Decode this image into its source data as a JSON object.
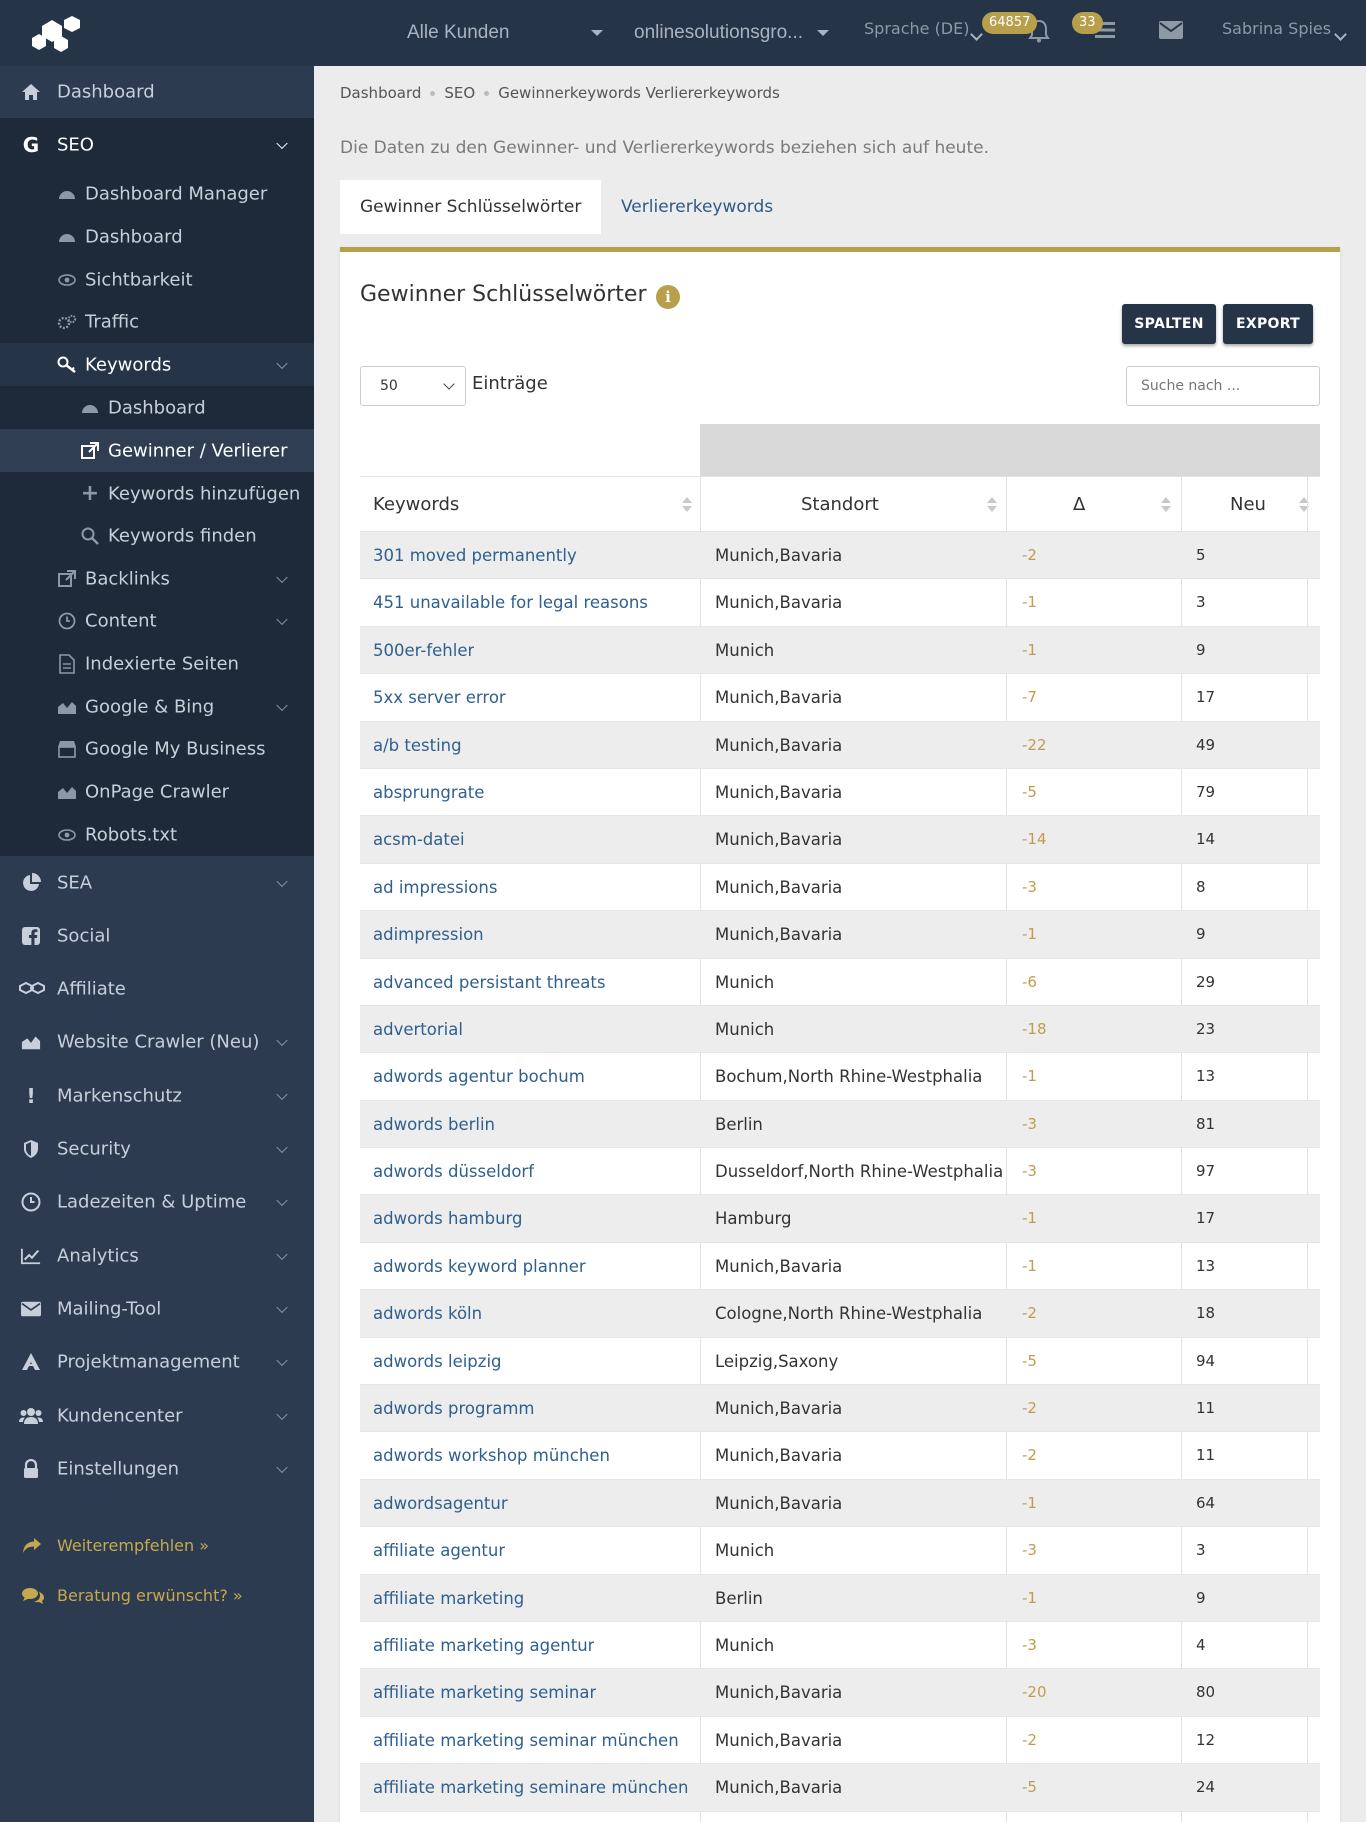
{
  "topbar": {
    "customer_select": "Alle Kunden",
    "project_select": "onlinesolutionsgro...",
    "language": "Sprache (DE)",
    "notifications_count": "64857",
    "tasks_count": "33",
    "user_name": "Sabrina Spies"
  },
  "sidebar": {
    "dashboard": "Dashboard",
    "seo": "SEO",
    "seo_items": {
      "dashboard_manager": "Dashboard Manager",
      "dashboard": "Dashboard",
      "sichtbarkeit": "Sichtbarkeit",
      "traffic": "Traffic",
      "keywords": "Keywords",
      "kw_dashboard": "Dashboard",
      "kw_gewinner": "Gewinner / Verlierer",
      "kw_add": "Keywords hinzufügen",
      "kw_find": "Keywords finden",
      "backlinks": "Backlinks",
      "content": "Content",
      "indexierte": "Indexierte Seiten",
      "google_bing": "Google & Bing",
      "gmb": "Google My Business",
      "onpage": "OnPage Crawler",
      "robots": "Robots.txt"
    },
    "sea": "SEA",
    "social": "Social",
    "affiliate": "Affiliate",
    "website_crawler": "Website Crawler (Neu)",
    "markenschutz": "Markenschutz",
    "security": "Security",
    "ladezeiten": "Ladezeiten & Uptime",
    "analytics": "Analytics",
    "mailing": "Mailing-Tool",
    "projekt": "Projektmanagement",
    "kundencenter": "Kundencenter",
    "einstellungen": "Einstellungen",
    "weiterempfehlen": "Weiterempfehlen »",
    "beratung": "Beratung erwünscht? »"
  },
  "breadcrumb": [
    "Dashboard",
    "SEO",
    "Gewinnerkeywords Verliererkeywords"
  ],
  "info_line": "Die Daten zu den Gewinner- und Verliererkeywords beziehen sich auf heute.",
  "tabs": [
    "Gewinner Schlüsselwörter",
    "Verliererkeywords"
  ],
  "panel": {
    "title": "Gewinner Schlüsselwörter",
    "spalten": "SPALTEN",
    "export": "EXPORT",
    "entries_value": "50",
    "entries_label": "Einträge",
    "search_placeholder": "Suche nach ..."
  },
  "table": {
    "columns": [
      "Keywords",
      "Standort",
      "Δ",
      "Neu"
    ],
    "rows": [
      [
        "301 moved permanently",
        "Munich,Bavaria",
        "-2",
        "5"
      ],
      [
        "451 unavailable for legal reasons",
        "Munich,Bavaria",
        "-1",
        "3"
      ],
      [
        "500er-fehler",
        "Munich",
        "-1",
        "9"
      ],
      [
        "5xx server error",
        "Munich,Bavaria",
        "-7",
        "17"
      ],
      [
        "a/b testing",
        "Munich,Bavaria",
        "-22",
        "49"
      ],
      [
        "absprungrate",
        "Munich,Bavaria",
        "-5",
        "79"
      ],
      [
        "acsm-datei",
        "Munich,Bavaria",
        "-14",
        "14"
      ],
      [
        "ad impressions",
        "Munich,Bavaria",
        "-3",
        "8"
      ],
      [
        "adimpression",
        "Munich,Bavaria",
        "-1",
        "9"
      ],
      [
        "advanced persistant threats",
        "Munich",
        "-6",
        "29"
      ],
      [
        "advertorial",
        "Munich",
        "-18",
        "23"
      ],
      [
        "adwords agentur bochum",
        "Bochum,North Rhine-Westphalia",
        "-1",
        "13"
      ],
      [
        "adwords berlin",
        "Berlin",
        "-3",
        "81"
      ],
      [
        "adwords düsseldorf",
        "Dusseldorf,North Rhine-Westphalia",
        "-3",
        "97"
      ],
      [
        "adwords hamburg",
        "Hamburg",
        "-1",
        "17"
      ],
      [
        "adwords keyword planner",
        "Munich,Bavaria",
        "-1",
        "13"
      ],
      [
        "adwords köln",
        "Cologne,North Rhine-Westphalia",
        "-2",
        "18"
      ],
      [
        "adwords leipzig",
        "Leipzig,Saxony",
        "-5",
        "94"
      ],
      [
        "adwords programm",
        "Munich,Bavaria",
        "-2",
        "11"
      ],
      [
        "adwords workshop münchen",
        "Munich,Bavaria",
        "-2",
        "11"
      ],
      [
        "adwordsagentur",
        "Munich,Bavaria",
        "-1",
        "64"
      ],
      [
        "affiliate agentur",
        "Munich",
        "-3",
        "3"
      ],
      [
        "affiliate marketing",
        "Berlin",
        "-1",
        "9"
      ],
      [
        "affiliate marketing agentur",
        "Munich",
        "-3",
        "4"
      ],
      [
        "affiliate marketing seminar",
        "Munich,Bavaria",
        "-20",
        "80"
      ],
      [
        "affiliate marketing seminar münchen",
        "Munich,Bavaria",
        "-2",
        "12"
      ],
      [
        "affiliate marketing seminare münchen",
        "Munich,Bavaria",
        "-5",
        "24"
      ]
    ]
  },
  "colors": {
    "navy": "#253447",
    "sidebar": "#2c3b4f",
    "accent_gold": "#b89f4c",
    "link_blue": "#2f5f8f"
  }
}
